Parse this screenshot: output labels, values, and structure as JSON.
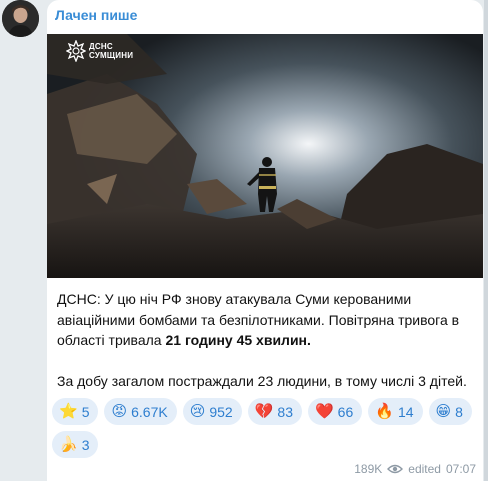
{
  "channel": {
    "name": "Лачен пише"
  },
  "photo": {
    "watermark_line1": "ДСНС",
    "watermark_line2": "СУМЩИНИ",
    "watermark_logo": "dsns-emblem-icon"
  },
  "post": {
    "p1_part1": "ДСНС: У цю ніч РФ знову атакувала Суми керованими авіаційними бомбами та безпілотниками. Повітряна тривога в області тривала ",
    "p1_bold": "21 годину 45 хвилин.",
    "p2": "За добу загалом постраждали 23 людини, в тому числі 3 дітей."
  },
  "reactions": [
    {
      "emoji": "⭐",
      "count": "5",
      "icon": "star-icon"
    },
    {
      "emoji": "😡",
      "count": "6.67K",
      "icon": "angry-face-icon"
    },
    {
      "emoji": "😢",
      "count": "952",
      "icon": "crying-face-icon"
    },
    {
      "emoji": "💔",
      "count": "83",
      "icon": "broken-heart-icon"
    },
    {
      "emoji": "❤️",
      "count": "66",
      "icon": "red-heart-icon"
    },
    {
      "emoji": "🔥",
      "count": "14",
      "icon": "fire-icon"
    },
    {
      "emoji": "😁",
      "count": "8",
      "icon": "grinning-face-icon"
    },
    {
      "emoji": "🍌",
      "count": "3",
      "icon": "banana-icon"
    }
  ],
  "meta": {
    "views": "189K",
    "edited": "edited",
    "time": "07:07",
    "eye_icon": "eye-icon"
  },
  "colors": {
    "accent": "#3a8dd6",
    "reaction_bg": "#e4eef9",
    "background": "#e6ebee"
  }
}
